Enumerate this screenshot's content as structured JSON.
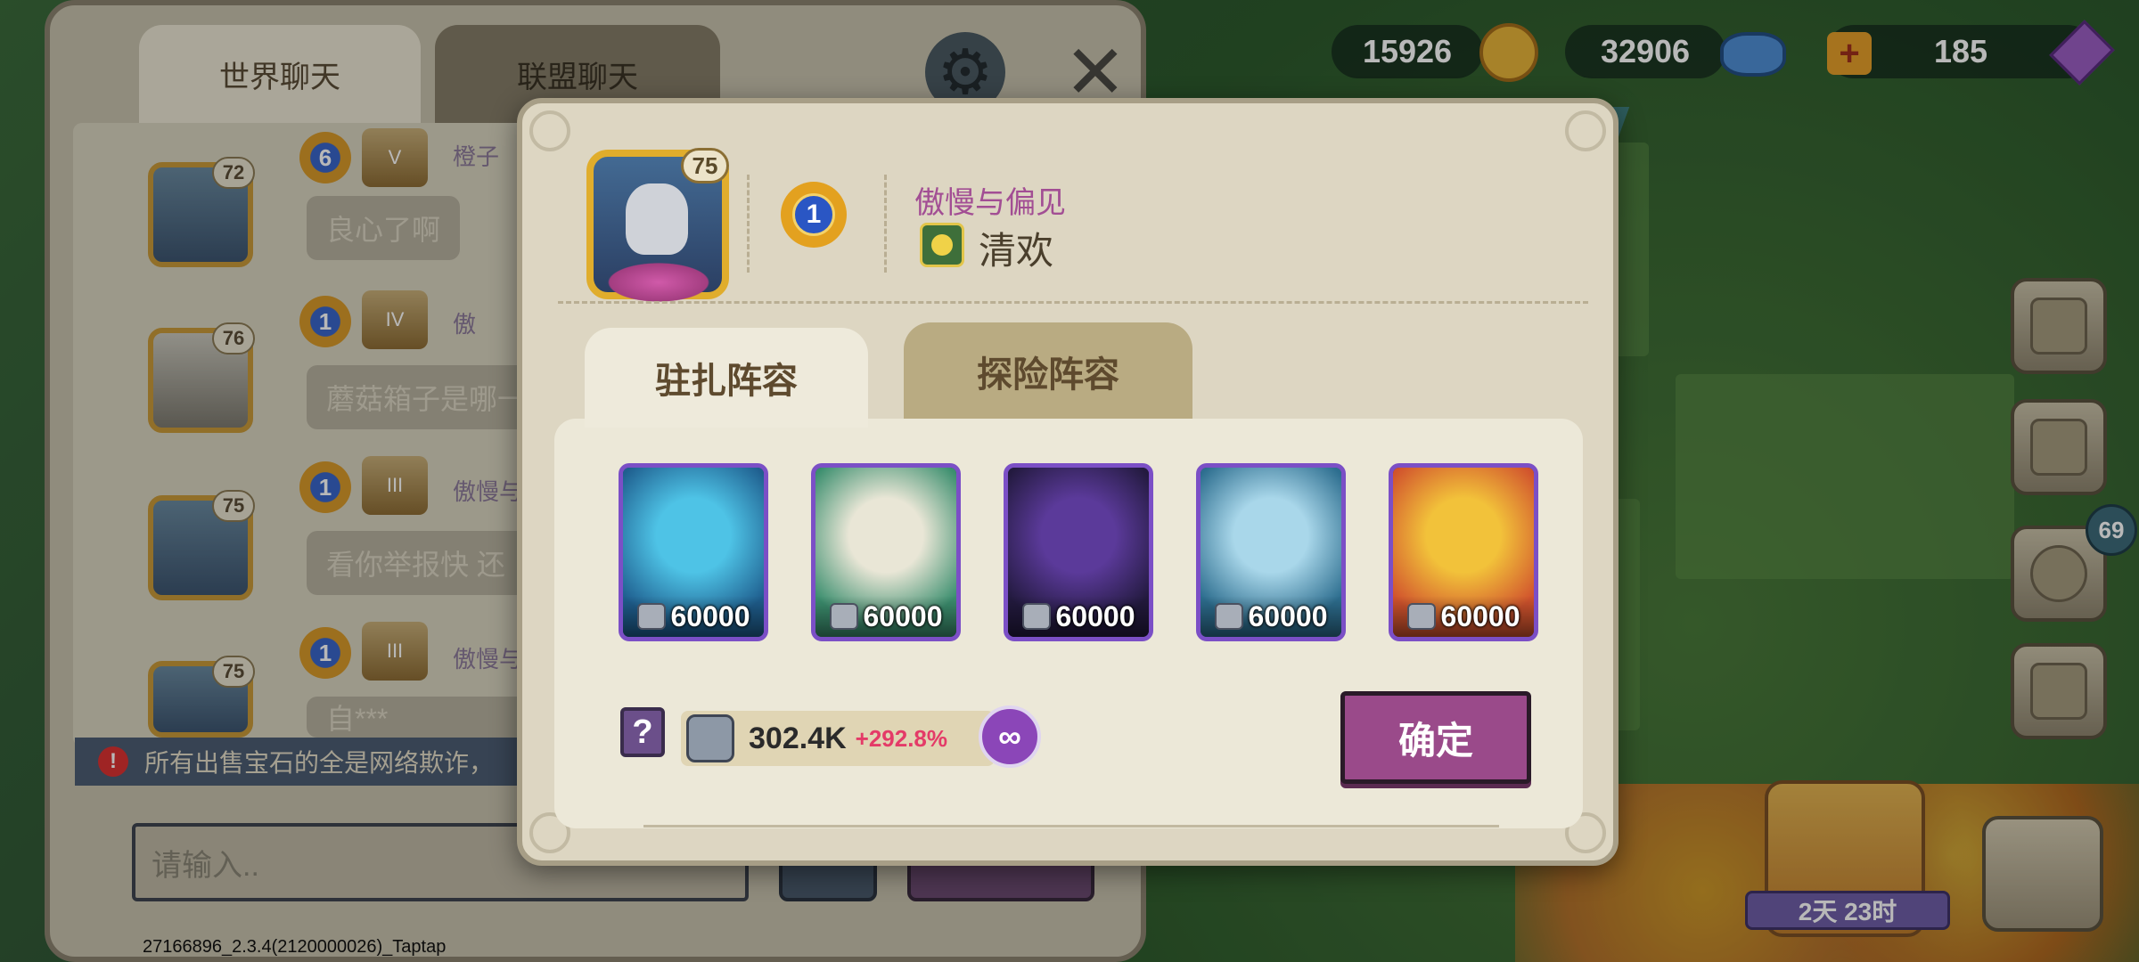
{
  "resources": [
    {
      "value": "15926",
      "icon": "gold-coin-icon",
      "color": "#e8b43a"
    },
    {
      "value": "32906",
      "icon": "blue-gem-icon",
      "color": "#4f8fd6"
    },
    {
      "value": "185",
      "icon": "purple-crystal-icon",
      "color": "#9b5fc4"
    }
  ],
  "chat": {
    "tabs": [
      "世界聊天",
      "联盟聊天"
    ],
    "messages": [
      {
        "level": "72",
        "medal": "6",
        "rank": "V",
        "name": "橙子",
        "text": "良心了啊"
      },
      {
        "level": "76",
        "medal": "1",
        "rank": "IV",
        "name": "傲",
        "text": "蘑菇箱子是哪一"
      },
      {
        "level": "75",
        "medal": "1",
        "rank": "III",
        "name": "傲慢与",
        "text": "看你举报快  还"
      },
      {
        "level": "75",
        "medal": "1",
        "rank": "III",
        "name": "傲慢与",
        "text": "自***"
      }
    ],
    "warning": "所有出售宝石的全是网络欺诈，",
    "input_placeholder": "请输入.."
  },
  "side_badge": "69",
  "timer": "2天 23时",
  "version": "27166896_2.3.4(2120000026)_Taptap",
  "profile": {
    "level": "75",
    "medal": "1",
    "alliance": "傲慢与偏见",
    "name": "清欢"
  },
  "tabs": {
    "active": "驻扎阵容",
    "inactive": "探险阵容"
  },
  "team": [
    {
      "power": "60000",
      "art": "ice-dragon",
      "c1": "#4ec3e6",
      "c2": "#1f5f8f"
    },
    {
      "power": "60000",
      "art": "white-horned-bird",
      "c1": "#e9e6d6",
      "c2": "#3c8f6f"
    },
    {
      "power": "60000",
      "art": "shadow-dragon",
      "c1": "#5b3a9a",
      "c2": "#231a3f"
    },
    {
      "power": "60000",
      "art": "frost-dragon",
      "c1": "#a9d7ea",
      "c2": "#2d6e8f"
    },
    {
      "power": "60000",
      "art": "fire-phoenix",
      "c1": "#f2c23a",
      "c2": "#d1532d"
    }
  ],
  "total_power": "302.4K",
  "power_bonus": "+292.8%",
  "help_label": "?",
  "confirm_label": "确定"
}
